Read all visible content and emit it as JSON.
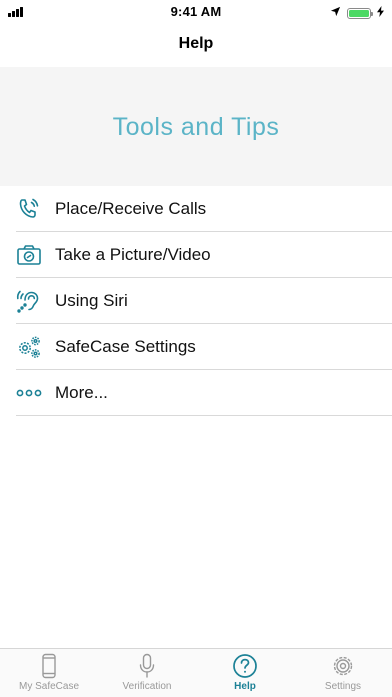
{
  "status_bar": {
    "time": "9:41 AM",
    "signal_icon": "signal-bars-icon",
    "location_icon": "location-arrow-icon",
    "battery_icon": "battery-icon",
    "charging_icon": "charging-bolt-icon",
    "battery_level": 1.0
  },
  "nav": {
    "title": "Help"
  },
  "hero": {
    "title": "Tools and Tips"
  },
  "menu": {
    "items": [
      {
        "label": "Place/Receive Calls",
        "icon": "phone-call-icon"
      },
      {
        "label": "Take a Picture/Video",
        "icon": "camera-icon"
      },
      {
        "label": "Using Siri",
        "icon": "hearing-assist-icon"
      },
      {
        "label": "SafeCase Settings",
        "icon": "gears-icon"
      },
      {
        "label": "More...",
        "icon": "more-dots-icon"
      }
    ]
  },
  "tab_bar": {
    "tabs": [
      {
        "label": "My SafeCase",
        "icon": "phone-device-icon",
        "active": false
      },
      {
        "label": "Verification",
        "icon": "microphone-icon",
        "active": false
      },
      {
        "label": "Help",
        "icon": "help-question-icon",
        "active": true
      },
      {
        "label": "Settings",
        "icon": "settings-gear-icon",
        "active": false
      }
    ]
  },
  "colors": {
    "accent": "#1c8196",
    "hero_text": "#5bb4c7",
    "hero_bg": "#f5f5f5",
    "inactive": "#999999",
    "battery": "#4cd964"
  }
}
